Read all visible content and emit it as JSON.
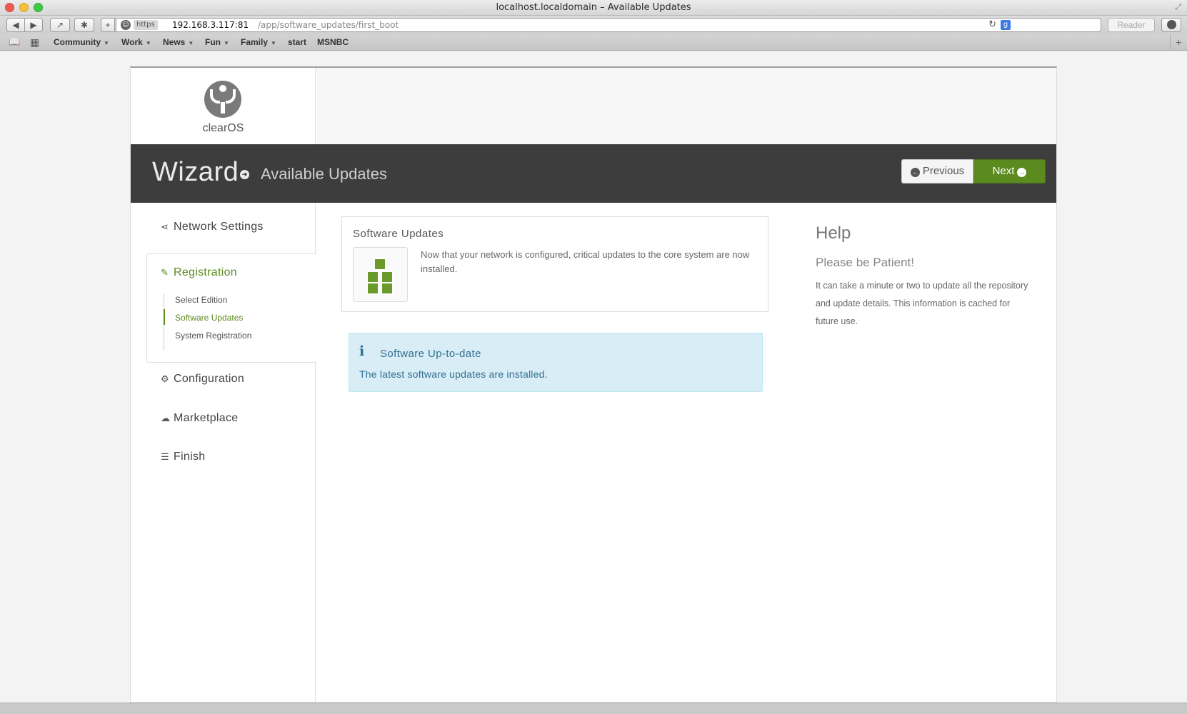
{
  "window": {
    "title": "localhost.localdomain – Available Updates"
  },
  "toolbar": {
    "https_label": "https",
    "url_host": "192.168.3.117:81",
    "url_path": "/app/software_updates/first_boot",
    "reader_label": "Reader"
  },
  "bookmarks": {
    "items": [
      {
        "label": "Community",
        "has_menu": true
      },
      {
        "label": "Work",
        "has_menu": true
      },
      {
        "label": "News",
        "has_menu": true
      },
      {
        "label": "Fun",
        "has_menu": true
      },
      {
        "label": "Family",
        "has_menu": true
      },
      {
        "label": "start",
        "has_menu": false
      },
      {
        "label": "MSNBC",
        "has_menu": false
      }
    ]
  },
  "app": {
    "logo_text": "clearOS",
    "wizard_title": "Wizard",
    "breadcrumb": "Available Updates",
    "previous_label": "Previous",
    "next_label": "Next",
    "accent_color": "#5b8a1f"
  },
  "sidebar": {
    "network": "Network Settings",
    "registration": "Registration",
    "sub_items": [
      "Select Edition",
      "Software Updates",
      "System Registration"
    ],
    "active_sub_item": "Software Updates",
    "configuration": "Configuration",
    "marketplace": "Marketplace",
    "finish": "Finish"
  },
  "main": {
    "box_title": "Software Updates",
    "box_text": "Now that your network is configured, critical updates to the core system are now installed.",
    "info_title": "Software Up-to-date",
    "info_text": "The latest software updates are installed."
  },
  "help": {
    "title": "Help",
    "subtitle": "Please be Patient!",
    "text": "It can take a minute or two to update all the repository and update details. This information is cached for future use."
  }
}
